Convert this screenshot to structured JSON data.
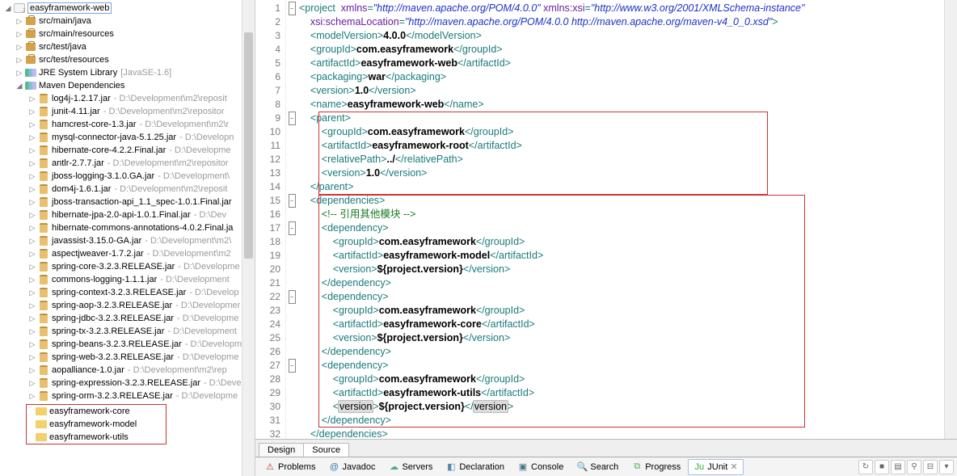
{
  "project": {
    "name": "easyframework-web"
  },
  "src_folders": [
    {
      "label": "src/main/java"
    },
    {
      "label": "src/main/resources"
    },
    {
      "label": "src/test/java"
    },
    {
      "label": "src/test/resources"
    }
  ],
  "jre": {
    "label": "JRE System Library",
    "qualifier": "[JavaSE-1.6]"
  },
  "maven": {
    "label": "Maven Dependencies"
  },
  "jars": [
    {
      "name": "log4j-1.2.17.jar",
      "path": "D:\\Development\\m2\\reposit"
    },
    {
      "name": "junit-4.11.jar",
      "path": "D:\\Development\\m2\\repositor"
    },
    {
      "name": "hamcrest-core-1.3.jar",
      "path": "D:\\Development\\m2\\r"
    },
    {
      "name": "mysql-connector-java-5.1.25.jar",
      "path": "D:\\Developn"
    },
    {
      "name": "hibernate-core-4.2.2.Final.jar",
      "path": "D:\\Developme"
    },
    {
      "name": "antlr-2.7.7.jar",
      "path": "D:\\Development\\m2\\repositor"
    },
    {
      "name": "jboss-logging-3.1.0.GA.jar",
      "path": "D:\\Development\\"
    },
    {
      "name": "dom4j-1.6.1.jar",
      "path": "D:\\Development\\m2\\reposit"
    },
    {
      "name": "jboss-transaction-api_1.1_spec-1.0.1.Final.jar",
      "path": ""
    },
    {
      "name": "hibernate-jpa-2.0-api-1.0.1.Final.jar",
      "path": "D:\\Dev"
    },
    {
      "name": "hibernate-commons-annotations-4.0.2.Final.ja",
      "path": ""
    },
    {
      "name": "javassist-3.15.0-GA.jar",
      "path": "D:\\Development\\m2\\"
    },
    {
      "name": "aspectjweaver-1.7.2.jar",
      "path": "D:\\Development\\m2"
    },
    {
      "name": "spring-core-3.2.3.RELEASE.jar",
      "path": "D:\\Developme"
    },
    {
      "name": "commons-logging-1.1.1.jar",
      "path": "D:\\Development"
    },
    {
      "name": "spring-context-3.2.3.RELEASE.jar",
      "path": "D:\\Develop"
    },
    {
      "name": "spring-aop-3.2.3.RELEASE.jar",
      "path": "D:\\Developmer"
    },
    {
      "name": "spring-jdbc-3.2.3.RELEASE.jar",
      "path": "D:\\Developme"
    },
    {
      "name": "spring-tx-3.2.3.RELEASE.jar",
      "path": "D:\\Development"
    },
    {
      "name": "spring-beans-3.2.3.RELEASE.jar",
      "path": "D:\\Developm"
    },
    {
      "name": "spring-web-3.2.3.RELEASE.jar",
      "path": "D:\\Developme"
    },
    {
      "name": "aopalliance-1.0.jar",
      "path": "D:\\Development\\m2\\rep"
    },
    {
      "name": "spring-expression-3.2.3.RELEASE.jar",
      "path": "D:\\Deve"
    },
    {
      "name": "spring-orm-3.2.3.RELEASE.jar",
      "path": "D:\\Developme"
    }
  ],
  "sub_projects": [
    {
      "label": "easyframework-core"
    },
    {
      "label": "easyframework-model"
    },
    {
      "label": "easyframework-utils"
    }
  ],
  "xml": {
    "ns1": "http://maven.apache.org/POM/4.0.0",
    "ns2": "http://www.w3.org/2001/XMLSchema-instance",
    "schema": "http://maven.apache.org/POM/4.0.0 http://maven.apache.org/maven-v4_0_0.xsd",
    "modelVersion": "4.0.0",
    "groupId": "com.easyframework",
    "artifactId": "easyframework-web",
    "packaging": "war",
    "version": "1.0",
    "name": "easyframework-web",
    "parent": {
      "groupId": "com.easyframework",
      "artifactId": "easyframework-root",
      "relativePath": "../",
      "version": "1.0"
    },
    "comment": "引用其他模块",
    "dep1": {
      "g": "com.easyframework",
      "a": "easyframework-model",
      "v": "${project.version}"
    },
    "dep2": {
      "g": "com.easyframework",
      "a": "easyframework-core",
      "v": "${project.version}"
    },
    "dep3": {
      "g": "com.easyframework",
      "a": "easyframework-utils",
      "v": "${project.version}"
    }
  },
  "editor_tabs": {
    "design": "Design",
    "source": "Source"
  },
  "views": [
    {
      "id": "problems",
      "label": "Problems",
      "icon": "⚠",
      "c": "#c33"
    },
    {
      "id": "javadoc",
      "label": "Javadoc",
      "icon": "@",
      "c": "#37a"
    },
    {
      "id": "servers",
      "label": "Servers",
      "icon": "☁",
      "c": "#5a8"
    },
    {
      "id": "declaration",
      "label": "Declaration",
      "icon": "◧",
      "c": "#58a"
    },
    {
      "id": "console",
      "label": "Console",
      "icon": "▣",
      "c": "#478"
    },
    {
      "id": "search",
      "label": "Search",
      "icon": "🔍",
      "c": "#888"
    },
    {
      "id": "progress",
      "label": "Progress",
      "icon": "⧉",
      "c": "#5a5"
    },
    {
      "id": "junit",
      "label": "JUnit",
      "icon": "Ju",
      "c": "#3a3",
      "active": true
    }
  ],
  "path_sep": " - "
}
